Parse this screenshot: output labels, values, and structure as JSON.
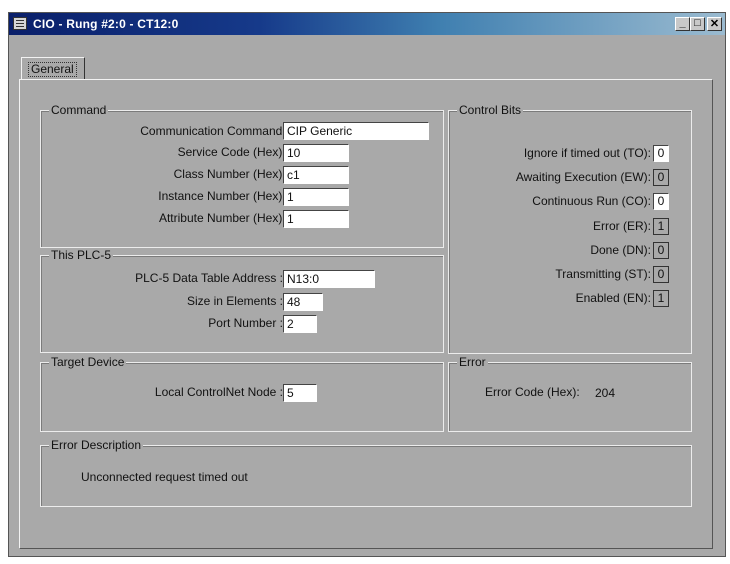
{
  "window": {
    "title": "CIO - Rung #2:0 - CT12:0",
    "minimize": "_",
    "maximize": "□",
    "close": "✕"
  },
  "tabs": [
    {
      "label": "General",
      "selected": true
    }
  ],
  "command": {
    "legend": "Command",
    "communication_command": {
      "label": "Communication Command :",
      "value": "CIP Generic"
    },
    "service_code": {
      "label": "Service Code (Hex) :",
      "value": "10"
    },
    "class_number": {
      "label": "Class Number (Hex) :",
      "value": "c1"
    },
    "instance_number": {
      "label": "Instance Number (Hex) :",
      "value": "1"
    },
    "attribute_number": {
      "label": "Attribute Number (Hex) :",
      "value": "1"
    }
  },
  "this_plc": {
    "legend": "This PLC-5",
    "data_table_address": {
      "label": "PLC-5 Data Table Address :",
      "value": "N13:0"
    },
    "size_in_elements": {
      "label": "Size in Elements :",
      "value": "48"
    },
    "port_number": {
      "label": "Port Number :",
      "value": "2"
    }
  },
  "target_device": {
    "legend": "Target Device",
    "local_controlnet_node": {
      "label": "Local ControlNet Node :",
      "value": "5"
    }
  },
  "control_bits": {
    "legend": "Control Bits",
    "bits": [
      {
        "label": "Ignore if timed out (TO):",
        "value": "0",
        "editable": true
      },
      {
        "label": "Awaiting Execution (EW):",
        "value": "0",
        "editable": false
      },
      {
        "label": "Continuous Run (CO):",
        "value": "0",
        "editable": true
      },
      {
        "label": "Error (ER):",
        "value": "1",
        "editable": false
      },
      {
        "label": "Done (DN):",
        "value": "0",
        "editable": false
      },
      {
        "label": "Transmitting (ST):",
        "value": "0",
        "editable": false
      },
      {
        "label": "Enabled (EN):",
        "value": "1",
        "editable": false
      }
    ]
  },
  "error": {
    "legend": "Error",
    "code_label": "Error Code (Hex):",
    "code_value": "204"
  },
  "error_description": {
    "legend": "Error Description",
    "text": "Unconnected request timed out"
  },
  "colors": {
    "face": "#a9a9a9",
    "title_start": "#0a1f6a",
    "title_end": "#9bbbd0"
  }
}
